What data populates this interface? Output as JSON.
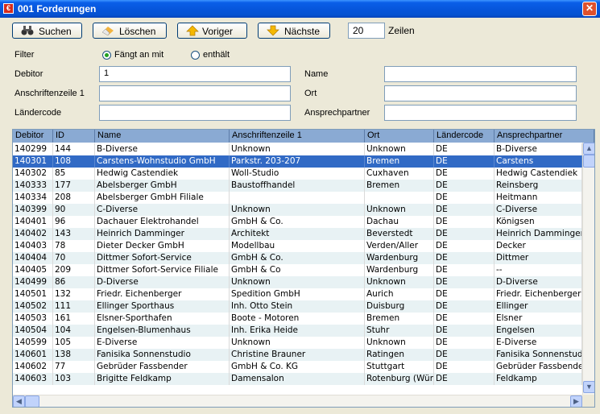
{
  "window": {
    "title": "001 Forderungen",
    "app_icon": "€",
    "close_glyph": "✕"
  },
  "toolbar": {
    "search_label": "Suchen",
    "search_icon": "binoculars-icon",
    "delete_label": "Löschen",
    "delete_icon": "eraser-icon",
    "prev_label": "Voriger",
    "prev_icon": "arrow-up-icon",
    "next_label": "Nächste",
    "next_icon": "arrow-down-icon",
    "rows_value": "20",
    "rows_label": "Zeilen"
  },
  "filter": {
    "label": "Filter",
    "option_starts": "Fängt an mit",
    "option_contains": "enthält",
    "selected": "Fängt an mit"
  },
  "form": {
    "debitor_label": "Debitor",
    "debitor_value": "1",
    "name_label": "Name",
    "name_value": "",
    "address_label": "Anschriftenzeile 1",
    "address_value": "",
    "city_label": "Ort",
    "city_value": "",
    "country_label": "Ländercode",
    "country_value": "",
    "contact_label": "Ansprechpartner",
    "contact_value": ""
  },
  "table": {
    "headers": [
      "Debitor",
      "ID",
      "Name",
      "Anschriftenzeile 1",
      "Ort",
      "Ländercode",
      "Ansprechpartner"
    ],
    "selected_index": 1,
    "rows": [
      [
        "140299",
        "144",
        "B-Diverse",
        "Unknown",
        "Unknown",
        "DE",
        "B-Diverse"
      ],
      [
        "140301",
        "108",
        "Carstens-Wohnstudio GmbH",
        "Parkstr. 203-207",
        "Bremen",
        "DE",
        "Carstens"
      ],
      [
        "140302",
        "85",
        "Hedwig Castendiek",
        "Woll-Studio",
        "Cuxhaven",
        "DE",
        "Hedwig Castendiek"
      ],
      [
        "140333",
        "177",
        "Abelsberger GmbH",
        "Baustoffhandel",
        "Bremen",
        "DE",
        "Reinsberg"
      ],
      [
        "140334",
        "208",
        "Abelsberger GmbH Filiale",
        "",
        "",
        "DE",
        "Heitmann"
      ],
      [
        "140399",
        "90",
        "C-Diverse",
        "Unknown",
        "Unknown",
        "DE",
        "C-Diverse"
      ],
      [
        "140401",
        "96",
        "Dachauer Elektrohandel",
        "GmbH & Co.",
        "Dachau",
        "DE",
        "Königsen"
      ],
      [
        "140402",
        "143",
        "Heinrich Damminger",
        "Architekt",
        "Beverstedt",
        "DE",
        "Heinrich Damminger"
      ],
      [
        "140403",
        "78",
        "Dieter Decker GmbH",
        "Modellbau",
        "Verden/Aller",
        "DE",
        "Decker"
      ],
      [
        "140404",
        "70",
        "Dittmer Sofort-Service",
        "GmbH & Co.",
        "Wardenburg",
        "DE",
        "Dittmer"
      ],
      [
        "140405",
        "209",
        "Dittmer Sofort-Service Filiale",
        "GmbH & Co",
        "Wardenburg",
        "DE",
        "--"
      ],
      [
        "140499",
        "86",
        "D-Diverse",
        "Unknown",
        "Unknown",
        "DE",
        "D-Diverse"
      ],
      [
        "140501",
        "132",
        "Friedr. Eichenberger",
        "Spedition GmbH",
        "Aurich",
        "DE",
        "Friedr. Eichenberger"
      ],
      [
        "140502",
        "111",
        "Ellinger Sporthaus",
        "Inh. Otto Stein",
        "Duisburg",
        "DE",
        "Ellinger"
      ],
      [
        "140503",
        "161",
        "Elsner-Sporthafen",
        "Boote - Motoren",
        "Bremen",
        "DE",
        "Elsner"
      ],
      [
        "140504",
        "104",
        "Engelsen-Blumenhaus",
        "Inh. Erika Heide",
        "Stuhr",
        "DE",
        "Engelsen"
      ],
      [
        "140599",
        "105",
        "E-Diverse",
        "Unknown",
        "Unknown",
        "DE",
        "E-Diverse"
      ],
      [
        "140601",
        "138",
        "Fanisika Sonnenstudio",
        "Christine Brauner",
        "Ratingen",
        "DE",
        "Fanisika Sonnenstudio"
      ],
      [
        "140602",
        "77",
        "Gebrüder Fassbender",
        "GmbH & Co. KG",
        "Stuttgart",
        "DE",
        "Gebrüder Fassbender"
      ],
      [
        "140603",
        "103",
        "Brigitte Feldkamp",
        "Damensalon",
        "Rotenburg (Wümme)",
        "DE",
        "Feldkamp"
      ]
    ]
  },
  "scrollbars": {
    "up": "▲",
    "down": "▼",
    "left": "◀",
    "right": "▶"
  },
  "colors": {
    "title_bar": "#0654d9",
    "header": "#8aaad3",
    "selection": "#316ac5",
    "alt_row": "#e8f2f4"
  }
}
